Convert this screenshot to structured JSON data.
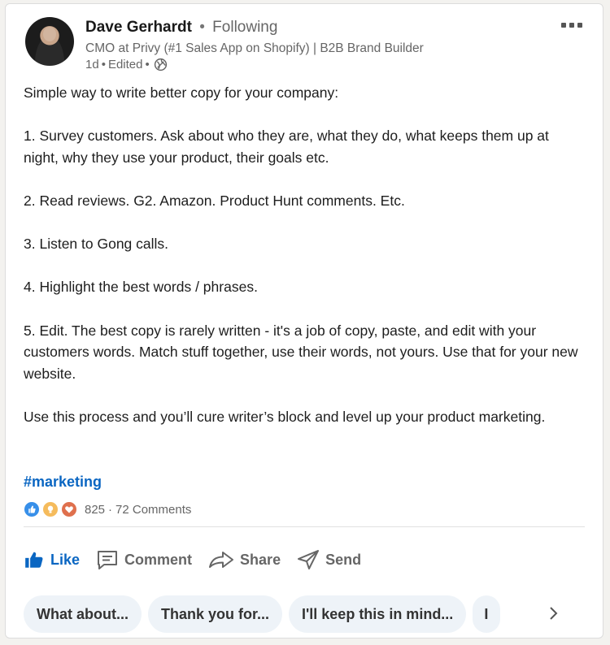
{
  "author": {
    "name": "Dave Gerhardt",
    "separator": "•",
    "follow_status": "Following",
    "headline": "CMO at Privy (#1 Sales App on Shopify) | B2B Brand Builder",
    "timestamp": "1d",
    "edited": "Edited"
  },
  "post": {
    "paragraphs": [
      "Simple way to write better copy for your company:",
      "1. Survey customers. Ask about who they are, what they do, what keeps them up at night, why they use your product, their goals etc.",
      "2. Read reviews. G2. Amazon. Product Hunt comments. Etc.",
      "3. Listen to Gong calls.",
      "4. Highlight the best words / phrases.",
      "5. Edit. The best copy is rarely written - it's a job of copy, paste, and edit with your customers words. Match stuff together, use their words, not yours. Use that for your new website.",
      "Use this process and you’ll cure writer’s block and level up your product marketing."
    ],
    "hashtag": "#marketing"
  },
  "social": {
    "reactions_count": "825",
    "separator": "·",
    "comments": "72 Comments",
    "reaction_icons": [
      "like-icon",
      "insightful-icon",
      "love-icon"
    ]
  },
  "actions": {
    "like": "Like",
    "comment": "Comment",
    "share": "Share",
    "send": "Send"
  },
  "suggested_replies": [
    "What about...",
    "Thank you for...",
    "I'll keep this in mind...",
    "I"
  ],
  "colors": {
    "accent": "#0a66c2",
    "like": "#378fe9",
    "insightful": "#f5bb5c",
    "love": "#df704d",
    "chip_bg": "#eef3f8"
  }
}
